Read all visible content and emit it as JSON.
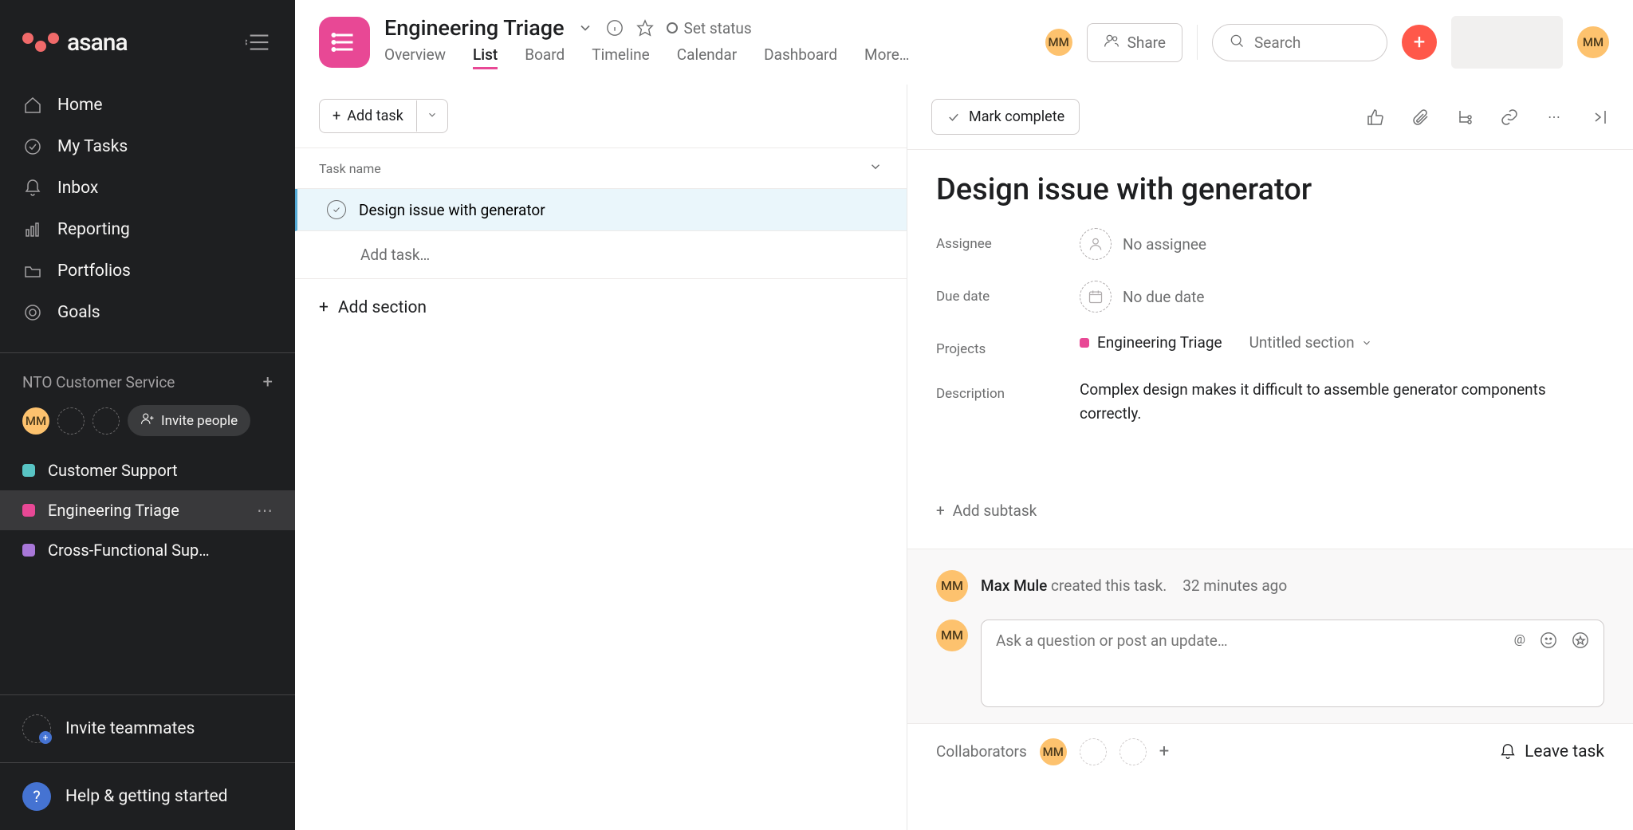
{
  "brand": "asana",
  "nav": {
    "home": "Home",
    "my_tasks": "My Tasks",
    "inbox": "Inbox",
    "reporting": "Reporting",
    "portfolios": "Portfolios",
    "goals": "Goals"
  },
  "workspace": {
    "name": "NTO Customer Service",
    "member_initials": "MM",
    "invite_people": "Invite people"
  },
  "projects": {
    "customer_support": {
      "label": "Customer Support",
      "color": "#58c4c4"
    },
    "engineering_triage": {
      "label": "Engineering Triage",
      "color": "#e84895"
    },
    "cross_functional": {
      "label": "Cross-Functional Sup…",
      "color": "#a877d8"
    }
  },
  "invite_teammates": "Invite teammates",
  "help": "Help & getting started",
  "header": {
    "title": "Engineering Triage",
    "set_status": "Set status",
    "tabs": {
      "overview": "Overview",
      "list": "List",
      "board": "Board",
      "timeline": "Timeline",
      "calendar": "Calendar",
      "dashboard": "Dashboard",
      "more": "More…"
    },
    "share": "Share",
    "search_placeholder": "Search",
    "member_initials": "MM",
    "right_avatar": "MM"
  },
  "list": {
    "add_task": "Add task",
    "col_task_name": "Task name",
    "task1": "Design issue with generator",
    "add_task_placeholder": "Add task…",
    "add_section": "Add section"
  },
  "detail": {
    "mark_complete": "Mark complete",
    "title": "Design issue with generator",
    "labels": {
      "assignee": "Assignee",
      "due_date": "Due date",
      "projects": "Projects",
      "description": "Description"
    },
    "assignee_value": "No assignee",
    "due_value": "No due date",
    "project_name": "Engineering Triage",
    "section": "Untitled section",
    "description": "Complex design makes it difficult to assemble generator components correctly.",
    "add_subtask": "Add subtask"
  },
  "activity": {
    "avatar": "MM",
    "who": "Max Mule",
    "action": " created this task.",
    "time": "32 minutes ago",
    "comment_placeholder": "Ask a question or post an update…"
  },
  "collab": {
    "label": "Collaborators",
    "avatar": "MM",
    "leave": "Leave task"
  }
}
